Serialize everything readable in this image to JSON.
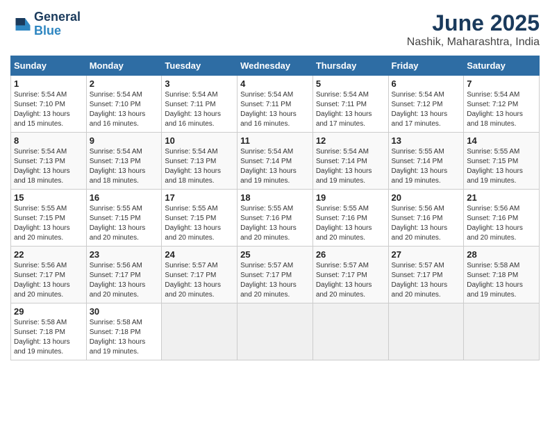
{
  "logo": {
    "line1": "General",
    "line2": "Blue"
  },
  "title": "June 2025",
  "subtitle": "Nashik, Maharashtra, India",
  "headers": [
    "Sunday",
    "Monday",
    "Tuesday",
    "Wednesday",
    "Thursday",
    "Friday",
    "Saturday"
  ],
  "weeks": [
    [
      {
        "day": "1",
        "info": "Sunrise: 5:54 AM\nSunset: 7:10 PM\nDaylight: 13 hours\nand 15 minutes."
      },
      {
        "day": "2",
        "info": "Sunrise: 5:54 AM\nSunset: 7:10 PM\nDaylight: 13 hours\nand 16 minutes."
      },
      {
        "day": "3",
        "info": "Sunrise: 5:54 AM\nSunset: 7:11 PM\nDaylight: 13 hours\nand 16 minutes."
      },
      {
        "day": "4",
        "info": "Sunrise: 5:54 AM\nSunset: 7:11 PM\nDaylight: 13 hours\nand 16 minutes."
      },
      {
        "day": "5",
        "info": "Sunrise: 5:54 AM\nSunset: 7:11 PM\nDaylight: 13 hours\nand 17 minutes."
      },
      {
        "day": "6",
        "info": "Sunrise: 5:54 AM\nSunset: 7:12 PM\nDaylight: 13 hours\nand 17 minutes."
      },
      {
        "day": "7",
        "info": "Sunrise: 5:54 AM\nSunset: 7:12 PM\nDaylight: 13 hours\nand 18 minutes."
      }
    ],
    [
      {
        "day": "8",
        "info": "Sunrise: 5:54 AM\nSunset: 7:13 PM\nDaylight: 13 hours\nand 18 minutes."
      },
      {
        "day": "9",
        "info": "Sunrise: 5:54 AM\nSunset: 7:13 PM\nDaylight: 13 hours\nand 18 minutes."
      },
      {
        "day": "10",
        "info": "Sunrise: 5:54 AM\nSunset: 7:13 PM\nDaylight: 13 hours\nand 18 minutes."
      },
      {
        "day": "11",
        "info": "Sunrise: 5:54 AM\nSunset: 7:14 PM\nDaylight: 13 hours\nand 19 minutes."
      },
      {
        "day": "12",
        "info": "Sunrise: 5:54 AM\nSunset: 7:14 PM\nDaylight: 13 hours\nand 19 minutes."
      },
      {
        "day": "13",
        "info": "Sunrise: 5:55 AM\nSunset: 7:14 PM\nDaylight: 13 hours\nand 19 minutes."
      },
      {
        "day": "14",
        "info": "Sunrise: 5:55 AM\nSunset: 7:15 PM\nDaylight: 13 hours\nand 19 minutes."
      }
    ],
    [
      {
        "day": "15",
        "info": "Sunrise: 5:55 AM\nSunset: 7:15 PM\nDaylight: 13 hours\nand 20 minutes."
      },
      {
        "day": "16",
        "info": "Sunrise: 5:55 AM\nSunset: 7:15 PM\nDaylight: 13 hours\nand 20 minutes."
      },
      {
        "day": "17",
        "info": "Sunrise: 5:55 AM\nSunset: 7:15 PM\nDaylight: 13 hours\nand 20 minutes."
      },
      {
        "day": "18",
        "info": "Sunrise: 5:55 AM\nSunset: 7:16 PM\nDaylight: 13 hours\nand 20 minutes."
      },
      {
        "day": "19",
        "info": "Sunrise: 5:55 AM\nSunset: 7:16 PM\nDaylight: 13 hours\nand 20 minutes."
      },
      {
        "day": "20",
        "info": "Sunrise: 5:56 AM\nSunset: 7:16 PM\nDaylight: 13 hours\nand 20 minutes."
      },
      {
        "day": "21",
        "info": "Sunrise: 5:56 AM\nSunset: 7:16 PM\nDaylight: 13 hours\nand 20 minutes."
      }
    ],
    [
      {
        "day": "22",
        "info": "Sunrise: 5:56 AM\nSunset: 7:17 PM\nDaylight: 13 hours\nand 20 minutes."
      },
      {
        "day": "23",
        "info": "Sunrise: 5:56 AM\nSunset: 7:17 PM\nDaylight: 13 hours\nand 20 minutes."
      },
      {
        "day": "24",
        "info": "Sunrise: 5:57 AM\nSunset: 7:17 PM\nDaylight: 13 hours\nand 20 minutes."
      },
      {
        "day": "25",
        "info": "Sunrise: 5:57 AM\nSunset: 7:17 PM\nDaylight: 13 hours\nand 20 minutes."
      },
      {
        "day": "26",
        "info": "Sunrise: 5:57 AM\nSunset: 7:17 PM\nDaylight: 13 hours\nand 20 minutes."
      },
      {
        "day": "27",
        "info": "Sunrise: 5:57 AM\nSunset: 7:17 PM\nDaylight: 13 hours\nand 20 minutes."
      },
      {
        "day": "28",
        "info": "Sunrise: 5:58 AM\nSunset: 7:18 PM\nDaylight: 13 hours\nand 19 minutes."
      }
    ],
    [
      {
        "day": "29",
        "info": "Sunrise: 5:58 AM\nSunset: 7:18 PM\nDaylight: 13 hours\nand 19 minutes."
      },
      {
        "day": "30",
        "info": "Sunrise: 5:58 AM\nSunset: 7:18 PM\nDaylight: 13 hours\nand 19 minutes."
      },
      {
        "day": "",
        "info": ""
      },
      {
        "day": "",
        "info": ""
      },
      {
        "day": "",
        "info": ""
      },
      {
        "day": "",
        "info": ""
      },
      {
        "day": "",
        "info": ""
      }
    ]
  ]
}
